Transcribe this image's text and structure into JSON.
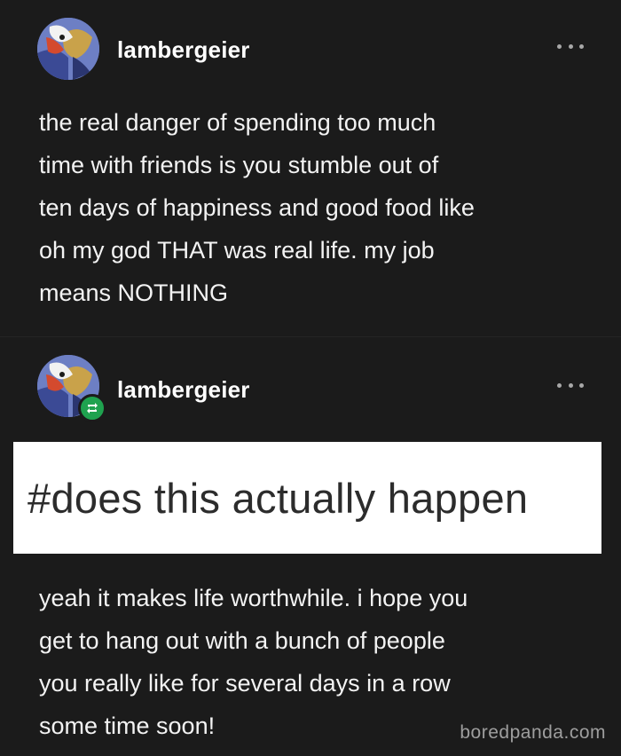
{
  "post1": {
    "username": "lambergeier",
    "more_icon": "ellipsis-icon",
    "text_lines": [
      "the real danger of spending too much",
      "time with friends is you stumble out of",
      "ten days of happiness and good food like",
      "oh my god THAT was real life. my job",
      "means NOTHING"
    ]
  },
  "post2": {
    "username": "lambergeier",
    "more_icon": "ellipsis-icon",
    "badge_icon": "reblog-icon",
    "tag": "#does this actually happen",
    "text_lines": [
      "yeah it makes life worthwhile. i hope you",
      "get to hang out with a bunch of people",
      "you really like for several days in a row",
      "some time soon!"
    ]
  },
  "watermark": "boredpanda.com",
  "colors": {
    "background": "#1b1b1b",
    "text": "#f3f3f3",
    "reblog_badge": "#1fa24f",
    "tag_background": "#ffffff"
  }
}
